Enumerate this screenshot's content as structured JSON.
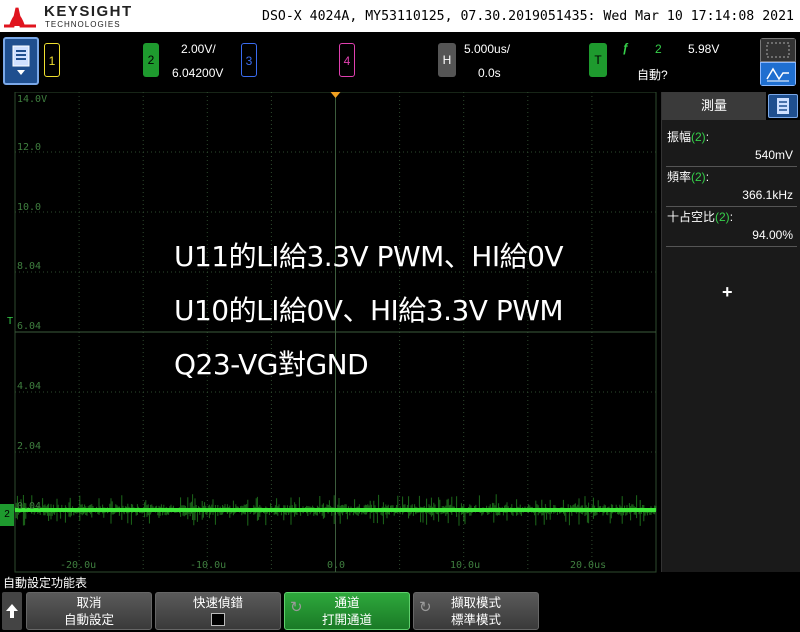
{
  "title_bar": {
    "brand": "KEYSIGHT",
    "brand_sub": "TECHNOLOGIES",
    "device_info": "DSO-X 4024A, MY53110125, 07.30.2019051435: Wed Mar 10 17:14:08 2021"
  },
  "channels": {
    "ch1_label": "1",
    "ch2_label": "2",
    "ch2_scale": "2.00V/",
    "ch2_offset": "6.04200V",
    "ch3_label": "3",
    "ch4_label": "4"
  },
  "horizontal": {
    "label": "H",
    "scale": "5.000us/",
    "delay": "0.0s"
  },
  "trigger": {
    "label": "T",
    "slope_icon": "rising-edge-icon",
    "source": "2",
    "level": "5.98V",
    "mode": "自動?"
  },
  "graticule": {
    "y_labels": [
      "14.0V",
      "12.0",
      "10.0",
      "8.04",
      "6.04",
      "4.04",
      "2.04",
      "0.04"
    ],
    "x_labels": [
      "-20.0u",
      "-10.0u",
      "0.0",
      "10.0u",
      "20.0us"
    ],
    "trigger_marker": "T",
    "ground_marker": "2",
    "trace_color": "#3ee83a",
    "grid_color": "#2e4a2e"
  },
  "overlay": {
    "line1": "U11的LI給3.3V PWM、HI給0V",
    "line2": "U10的LI給0V、HI給3.3V PWM",
    "line3": "Q23-VG對GND"
  },
  "measurements": {
    "tab_label": "測量",
    "items": [
      {
        "label": "振幅",
        "channel": "(2)",
        "suffix": ":",
        "value": "540mV"
      },
      {
        "label": "頻率",
        "channel": "(2)",
        "suffix": ":",
        "value": "366.1kHz"
      },
      {
        "label": "十占空比",
        "channel": "(2)",
        "suffix": ":",
        "value": "94.00%"
      }
    ],
    "add_label": "+"
  },
  "softkeys": {
    "menu_title": "自動設定功能表",
    "key1_line1": "取消",
    "key1_line2": "自動設定",
    "key2_line1": "快速偵錯",
    "key3_line1": "通道",
    "key3_line2": "打開通道",
    "key4_line1": "擷取模式",
    "key4_line2": "標準模式"
  }
}
